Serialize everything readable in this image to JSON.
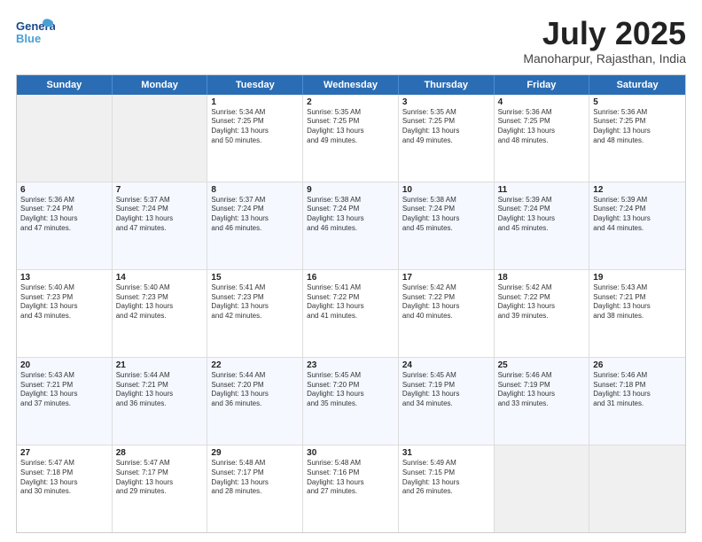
{
  "header": {
    "logo_line1": "General",
    "logo_line2": "Blue",
    "month_title": "July 2025",
    "subtitle": "Manoharpur, Rajasthan, India"
  },
  "day_headers": [
    "Sunday",
    "Monday",
    "Tuesday",
    "Wednesday",
    "Thursday",
    "Friday",
    "Saturday"
  ],
  "weeks": [
    [
      {
        "day": "",
        "info": ""
      },
      {
        "day": "",
        "info": ""
      },
      {
        "day": "1",
        "info": "Sunrise: 5:34 AM\nSunset: 7:25 PM\nDaylight: 13 hours\nand 50 minutes."
      },
      {
        "day": "2",
        "info": "Sunrise: 5:35 AM\nSunset: 7:25 PM\nDaylight: 13 hours\nand 49 minutes."
      },
      {
        "day": "3",
        "info": "Sunrise: 5:35 AM\nSunset: 7:25 PM\nDaylight: 13 hours\nand 49 minutes."
      },
      {
        "day": "4",
        "info": "Sunrise: 5:36 AM\nSunset: 7:25 PM\nDaylight: 13 hours\nand 48 minutes."
      },
      {
        "day": "5",
        "info": "Sunrise: 5:36 AM\nSunset: 7:25 PM\nDaylight: 13 hours\nand 48 minutes."
      }
    ],
    [
      {
        "day": "6",
        "info": "Sunrise: 5:36 AM\nSunset: 7:24 PM\nDaylight: 13 hours\nand 47 minutes."
      },
      {
        "day": "7",
        "info": "Sunrise: 5:37 AM\nSunset: 7:24 PM\nDaylight: 13 hours\nand 47 minutes."
      },
      {
        "day": "8",
        "info": "Sunrise: 5:37 AM\nSunset: 7:24 PM\nDaylight: 13 hours\nand 46 minutes."
      },
      {
        "day": "9",
        "info": "Sunrise: 5:38 AM\nSunset: 7:24 PM\nDaylight: 13 hours\nand 46 minutes."
      },
      {
        "day": "10",
        "info": "Sunrise: 5:38 AM\nSunset: 7:24 PM\nDaylight: 13 hours\nand 45 minutes."
      },
      {
        "day": "11",
        "info": "Sunrise: 5:39 AM\nSunset: 7:24 PM\nDaylight: 13 hours\nand 45 minutes."
      },
      {
        "day": "12",
        "info": "Sunrise: 5:39 AM\nSunset: 7:24 PM\nDaylight: 13 hours\nand 44 minutes."
      }
    ],
    [
      {
        "day": "13",
        "info": "Sunrise: 5:40 AM\nSunset: 7:23 PM\nDaylight: 13 hours\nand 43 minutes."
      },
      {
        "day": "14",
        "info": "Sunrise: 5:40 AM\nSunset: 7:23 PM\nDaylight: 13 hours\nand 42 minutes."
      },
      {
        "day": "15",
        "info": "Sunrise: 5:41 AM\nSunset: 7:23 PM\nDaylight: 13 hours\nand 42 minutes."
      },
      {
        "day": "16",
        "info": "Sunrise: 5:41 AM\nSunset: 7:22 PM\nDaylight: 13 hours\nand 41 minutes."
      },
      {
        "day": "17",
        "info": "Sunrise: 5:42 AM\nSunset: 7:22 PM\nDaylight: 13 hours\nand 40 minutes."
      },
      {
        "day": "18",
        "info": "Sunrise: 5:42 AM\nSunset: 7:22 PM\nDaylight: 13 hours\nand 39 minutes."
      },
      {
        "day": "19",
        "info": "Sunrise: 5:43 AM\nSunset: 7:21 PM\nDaylight: 13 hours\nand 38 minutes."
      }
    ],
    [
      {
        "day": "20",
        "info": "Sunrise: 5:43 AM\nSunset: 7:21 PM\nDaylight: 13 hours\nand 37 minutes."
      },
      {
        "day": "21",
        "info": "Sunrise: 5:44 AM\nSunset: 7:21 PM\nDaylight: 13 hours\nand 36 minutes."
      },
      {
        "day": "22",
        "info": "Sunrise: 5:44 AM\nSunset: 7:20 PM\nDaylight: 13 hours\nand 36 minutes."
      },
      {
        "day": "23",
        "info": "Sunrise: 5:45 AM\nSunset: 7:20 PM\nDaylight: 13 hours\nand 35 minutes."
      },
      {
        "day": "24",
        "info": "Sunrise: 5:45 AM\nSunset: 7:19 PM\nDaylight: 13 hours\nand 34 minutes."
      },
      {
        "day": "25",
        "info": "Sunrise: 5:46 AM\nSunset: 7:19 PM\nDaylight: 13 hours\nand 33 minutes."
      },
      {
        "day": "26",
        "info": "Sunrise: 5:46 AM\nSunset: 7:18 PM\nDaylight: 13 hours\nand 31 minutes."
      }
    ],
    [
      {
        "day": "27",
        "info": "Sunrise: 5:47 AM\nSunset: 7:18 PM\nDaylight: 13 hours\nand 30 minutes."
      },
      {
        "day": "28",
        "info": "Sunrise: 5:47 AM\nSunset: 7:17 PM\nDaylight: 13 hours\nand 29 minutes."
      },
      {
        "day": "29",
        "info": "Sunrise: 5:48 AM\nSunset: 7:17 PM\nDaylight: 13 hours\nand 28 minutes."
      },
      {
        "day": "30",
        "info": "Sunrise: 5:48 AM\nSunset: 7:16 PM\nDaylight: 13 hours\nand 27 minutes."
      },
      {
        "day": "31",
        "info": "Sunrise: 5:49 AM\nSunset: 7:15 PM\nDaylight: 13 hours\nand 26 minutes."
      },
      {
        "day": "",
        "info": ""
      },
      {
        "day": "",
        "info": ""
      }
    ]
  ]
}
